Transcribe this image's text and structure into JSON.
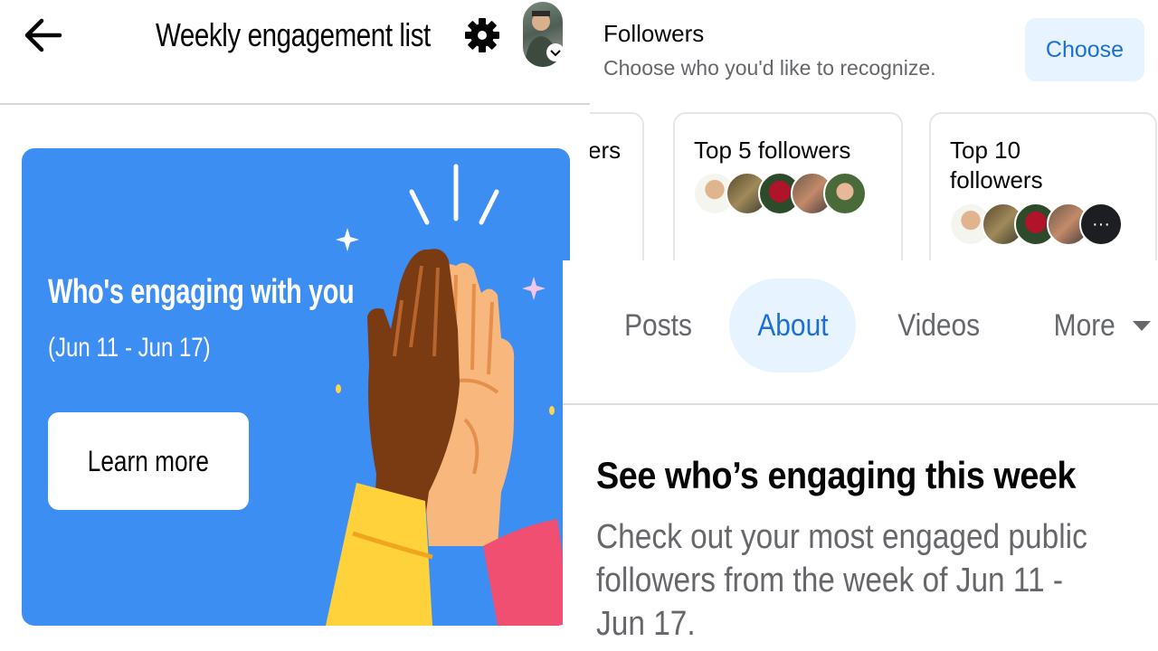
{
  "left_panel": {
    "header": {
      "title": "Weekly engagement list",
      "back_icon": "arrow-left-icon",
      "settings_icon": "gear-icon",
      "avatar_icon": "profile-avatar"
    },
    "banner": {
      "background": "#3d8ef2",
      "title": "Who's engaging with you",
      "date_range": "(Jun 11 - Jun 17)",
      "button_label": "Learn more",
      "illustration": "high-five-hands-illustration"
    }
  },
  "followers_panel": {
    "title": "Followers",
    "subtitle": "Choose who you'd like to recognize.",
    "choose_label": "Choose",
    "cards": [
      {
        "label": "ers"
      },
      {
        "label": "Top 5 followers"
      },
      {
        "label": "Top 10 followers",
        "more_icon": "ellipsis-icon",
        "more_glyph": "···"
      }
    ]
  },
  "profile_panel": {
    "tabs": [
      {
        "label": "Posts",
        "active": false
      },
      {
        "label": "About",
        "active": true
      },
      {
        "label": "Videos",
        "active": false
      },
      {
        "label": "More",
        "active": false
      }
    ],
    "heading": "See who’s engaging this week",
    "description": "Check out your most engaged public followers from the week of Jun 11 - Jun 17."
  },
  "colors": {
    "accent_blue": "#1b6fd6",
    "active_tab_bg": "#e7f3ff",
    "banner_blue": "#3d8ef2",
    "secondary_text": "#65676b"
  }
}
